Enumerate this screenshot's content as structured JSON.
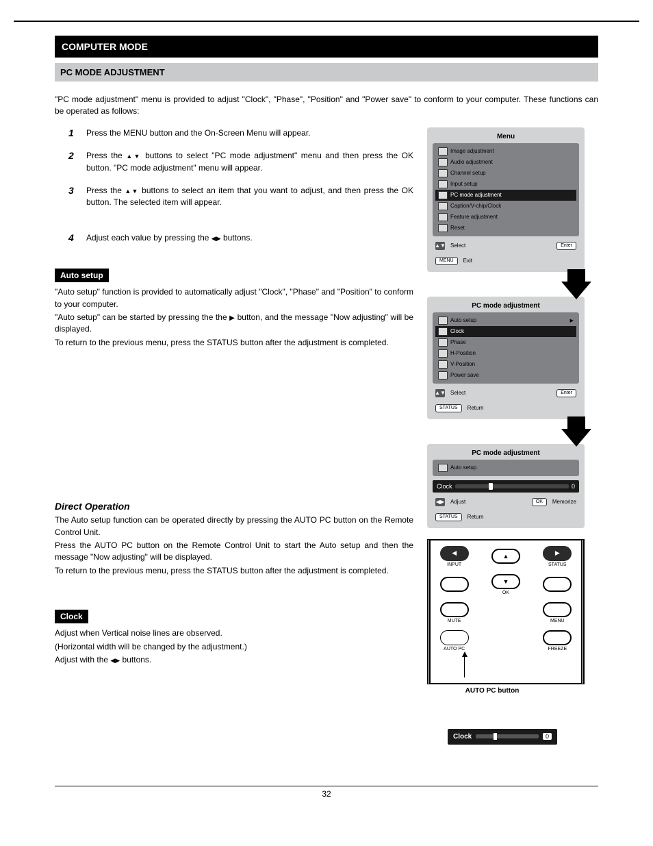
{
  "page": {
    "section_banner": "COMPUTER MODE",
    "subsection_banner": "PC MODE ADJUSTMENT",
    "intro": "\"PC mode adjustment\" menu is provided to adjust \"Clock\", \"Phase\", \"Position\" and \"Power save\" to conform to your computer.  These functions can be operated as follows:",
    "steps": {
      "s1": {
        "n": "1",
        "t": "Press the MENU button and the On-Screen Menu will appear."
      },
      "s2": {
        "n": "2",
        "pre": "Press the ",
        "post": " buttons to select \"PC mode adjustment\" menu and then press the OK button. \"PC mode adjustment\" menu will appear."
      },
      "s3": {
        "n": "3",
        "pre": "Press the ",
        "post": " buttons to select an item that you want to adjust, and then press the OK button. The selected item will appear."
      },
      "s4": {
        "n": "4",
        "pre": "Adjust each value by pressing the ",
        "post": " buttons."
      }
    },
    "auto_setup": {
      "head": "Auto setup",
      "p1": "\"Auto setup\" function is provided to automatically adjust \"Clock\", \"Phase\" and \"Position\" to conform to your computer.",
      "p2a": "\"Auto setup\" can be started by pressing the the ",
      "p2b": " button, and the message \"Now adjusting\" will be displayed.",
      "p3": "To return to the previous menu, press the STATUS button after the adjustment is completed."
    },
    "direct": {
      "head": "Direct Operation",
      "p1": "The Auto setup function can be operated directly by pressing the AUTO PC button on the Remote Control Unit.",
      "p2": "Press the AUTO PC button on the Remote Control Unit to start the Auto setup and then the message \"Now adjusting\" will be displayed.",
      "p3": "To return to the previous menu, press the STATUS button after the adjustment is completed."
    },
    "clock": {
      "head": "Clock",
      "p1": "Adjust when Vertical noise lines are observed.",
      "p2": "(Horizontal width will be changed by the adjustment.)",
      "p3a": "Adjust with the ",
      "p3b": " buttons."
    },
    "footer_page": "32"
  },
  "osd1": {
    "title": "Menu",
    "rows": [
      "Image adjustment",
      "Audio adjustment",
      "Channel setup",
      "Input setup",
      "PC mode adjustment",
      "Caption/V-chip/Clock",
      "Feature adjustment",
      "Reset"
    ],
    "selected_index": 4,
    "enter": "Enter",
    "select": "Select",
    "menu": "MENU",
    "exit": "Exit"
  },
  "osd2": {
    "title": "PC mode adjustment",
    "rows": [
      "Auto setup",
      "Clock",
      "Phase",
      "H-Position",
      "V-Position",
      "Power save"
    ],
    "selected_index": 1,
    "enter": "Enter",
    "select": "Select",
    "status": "STATUS",
    "return": "Return"
  },
  "osd3": {
    "title": "PC mode adjustment",
    "rows": [
      "Auto setup"
    ],
    "clock_label": "Clock",
    "clock_value": "0",
    "adjust": "Adjust",
    "status": "STATUS",
    "return": "Return",
    "ok": "OK",
    "memorize": "Memorize"
  },
  "remote": {
    "input": "INPUT",
    "status": "STATUS",
    "ok": "OK",
    "mute": "MUTE",
    "menu": "MENU",
    "autopc": "AUTO PC",
    "freeze": "FREEZE",
    "caption": "AUTO PC button"
  },
  "clockbox": {
    "label": "Clock",
    "value": "0"
  }
}
